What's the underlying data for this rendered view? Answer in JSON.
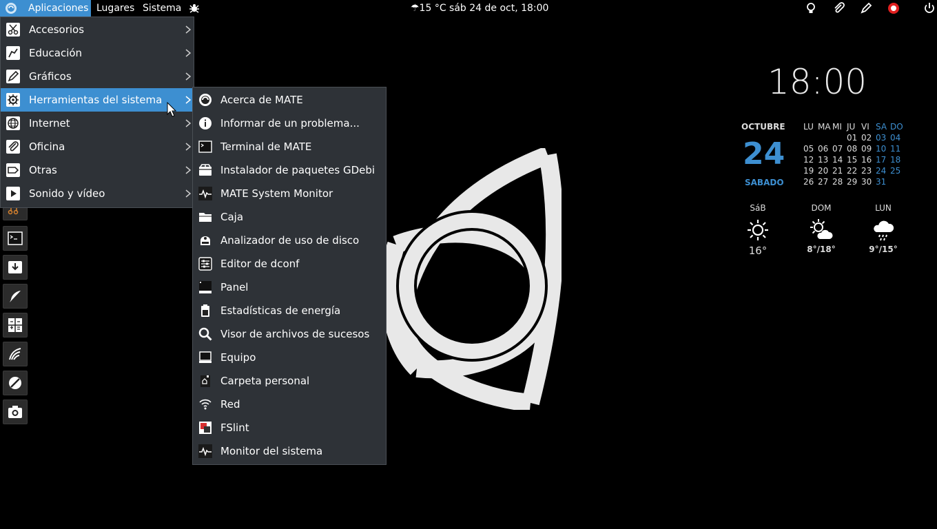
{
  "topbar": {
    "applications": "Aplicaciones",
    "places": "Lugares",
    "system": "Sistema",
    "weather_clock": "☂15 °C   sáb 24 de oct, 18:00"
  },
  "main_menu": {
    "items": [
      {
        "label": "Accesorios",
        "icon": "scissors-icon"
      },
      {
        "label": "Educación",
        "icon": "education-icon"
      },
      {
        "label": "Gráficos",
        "icon": "graphics-icon"
      },
      {
        "label": "Herramientas del sistema",
        "icon": "gear-icon",
        "active": true
      },
      {
        "label": "Internet",
        "icon": "globe-icon"
      },
      {
        "label": "Oficina",
        "icon": "paperclip-icon"
      },
      {
        "label": "Otras",
        "icon": "tag-icon"
      },
      {
        "label": "Sonido y vídeo",
        "icon": "play-icon"
      }
    ]
  },
  "sub_menu": {
    "items": [
      {
        "label": "Acerca de MATE",
        "icon": "mate-logo-icon"
      },
      {
        "label": "Informar de un problema...",
        "icon": "info-icon"
      },
      {
        "label": "Terminal de MATE",
        "icon": "terminal-icon"
      },
      {
        "label": "Instalador de paquetes GDebi",
        "icon": "package-icon"
      },
      {
        "label": "MATE System Monitor",
        "icon": "pulse-icon"
      },
      {
        "label": "Caja",
        "icon": "folder-icon"
      },
      {
        "label": "Analizador de uso de disco",
        "icon": "disk-icon"
      },
      {
        "label": "Editor de dconf",
        "icon": "sliders-icon"
      },
      {
        "label": "Panel",
        "icon": "panel-icon"
      },
      {
        "label": "Estadísticas de energía",
        "icon": "battery-icon"
      },
      {
        "label": "Visor de archivos de sucesos",
        "icon": "search-icon"
      },
      {
        "label": "Equipo",
        "icon": "computer-icon"
      },
      {
        "label": "Carpeta personal",
        "icon": "home-folder-icon"
      },
      {
        "label": "Red",
        "icon": "wifi-icon"
      },
      {
        "label": "FSlint",
        "icon": "fslint-icon"
      },
      {
        "label": "Monitor del sistema",
        "icon": "pulse-icon"
      }
    ]
  },
  "widget": {
    "time": "18:00",
    "month": "OCTUBRE",
    "day": "24",
    "weekday": "SABADO",
    "calendar": {
      "headers": [
        "LU",
        "MA",
        "MI",
        "JU",
        "VI",
        "SA",
        "DO"
      ],
      "rows": [
        [
          "",
          "",
          "",
          "01",
          "02",
          "03",
          "04"
        ],
        [
          "05",
          "06",
          "07",
          "08",
          "09",
          "10",
          "11"
        ],
        [
          "12",
          "13",
          "14",
          "15",
          "16",
          "17",
          "18"
        ],
        [
          "19",
          "20",
          "21",
          "22",
          "23",
          "24",
          "25"
        ],
        [
          "26",
          "27",
          "28",
          "29",
          "30",
          "31",
          ""
        ]
      ]
    },
    "forecast": [
      {
        "day": "SáB",
        "temp": "16°",
        "icon": "sun-icon"
      },
      {
        "day": "DOM",
        "temp": "8°/18°",
        "icon": "partly-cloudy-icon"
      },
      {
        "day": "LUN",
        "temp": "9°/15°",
        "icon": "rain-icon"
      }
    ]
  },
  "colors": {
    "accent": "#3d8fd1",
    "menu_bg": "#2e3237",
    "desktop": "#000000"
  }
}
